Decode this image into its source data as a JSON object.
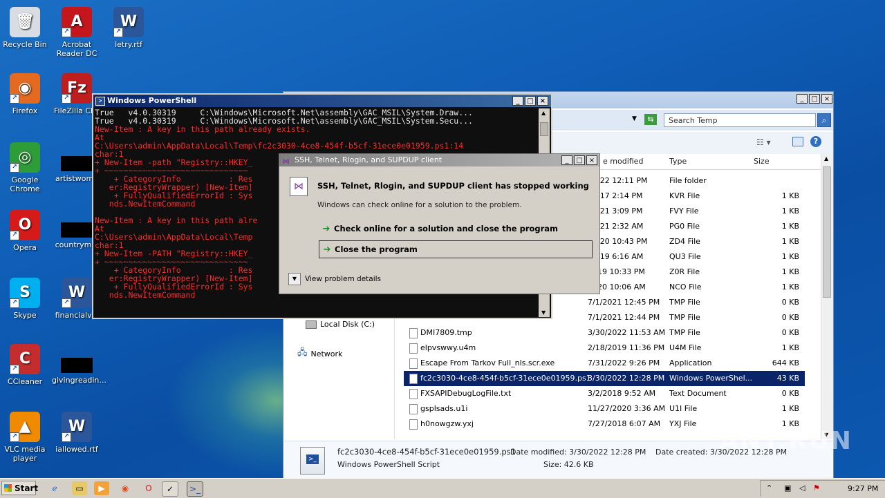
{
  "desktop": {
    "icons": [
      {
        "label": "Recycle Bin"
      },
      {
        "label": "Acrobat Reader DC"
      },
      {
        "label": "letry.rtf"
      },
      {
        "label": "Firefox"
      },
      {
        "label": "FileZilla Clie"
      },
      {
        "label": "Google Chrome"
      },
      {
        "label": "artistwome"
      },
      {
        "label": "Opera"
      },
      {
        "label": "countrymin"
      },
      {
        "label": "Skype"
      },
      {
        "label": "financialvol"
      },
      {
        "label": "CCleaner"
      },
      {
        "label": "givingreadin..."
      },
      {
        "label": "VLC media player"
      },
      {
        "label": "iallowed.rtf"
      }
    ]
  },
  "explorer": {
    "search_placeholder": "Search Temp",
    "columns": {
      "modified": "e modified",
      "type": "Type",
      "size": "Size"
    },
    "nav": [
      {
        "label": "Local Disk (C:)"
      },
      {
        "label": "Network"
      }
    ],
    "rows": [
      {
        "name": "",
        "modified": "/2022 12:11 PM",
        "type": "File folder",
        "size": ""
      },
      {
        "name": "",
        "modified": "/2017 2:14 PM",
        "type": "KVR File",
        "size": "1 KB"
      },
      {
        "name": "",
        "modified": "/2021 3:09 PM",
        "type": "FVY File",
        "size": "1 KB"
      },
      {
        "name": "",
        "modified": "/2021 2:32 AM",
        "type": "PG0 File",
        "size": "1 KB"
      },
      {
        "name": "",
        "modified": "/2020 10:43 PM",
        "type": "ZD4 File",
        "size": "1 KB"
      },
      {
        "name": "",
        "modified": "/2019 6:16 AM",
        "type": "QU3 File",
        "size": "1 KB"
      },
      {
        "name": "",
        "modified": "2019 10:33 PM",
        "type": "Z0R File",
        "size": "1 KB"
      },
      {
        "name": "",
        "modified": "2020 10:06 AM",
        "type": "NCO File",
        "size": "1 KB"
      },
      {
        "name": "",
        "modified": "7/1/2021 12:45 PM",
        "type": "TMP File",
        "size": "0 KB"
      },
      {
        "name": "",
        "modified": "7/1/2021 12:44 PM",
        "type": "TMP File",
        "size": "0 KB"
      },
      {
        "name": "DMI7809.tmp",
        "modified": "3/30/2022 11:53 AM",
        "type": "TMP File",
        "size": "0 KB"
      },
      {
        "name": "elpvswwy.u4m",
        "modified": "2/18/2019 11:36 PM",
        "type": "U4M File",
        "size": "1 KB"
      },
      {
        "name": "Escape From Tarkov Full_nls.scr.exe",
        "modified": "7/31/2022 9:26 PM",
        "type": "Application",
        "size": "644 KB"
      },
      {
        "name": "fc2c3030-4ce8-454f-b5cf-31ece0e01959.ps1",
        "modified": "3/30/2022 12:28 PM",
        "type": "Windows PowerShel...",
        "size": "43 KB"
      },
      {
        "name": "FXSAPIDebugLogFile.txt",
        "modified": "3/2/2018 9:52 AM",
        "type": "Text Document",
        "size": "0 KB"
      },
      {
        "name": "gsplsads.u1i",
        "modified": "11/27/2020 3:36 AM",
        "type": "U1I File",
        "size": "1 KB"
      },
      {
        "name": "h0nowgzw.yxj",
        "modified": "7/27/2018 6:07 AM",
        "type": "YXJ File",
        "size": "1 KB"
      }
    ],
    "details": {
      "filename": "fc2c3030-4ce8-454f-b5cf-31ece0e01959.ps1",
      "filetype": "Windows PowerShell Script",
      "date_modified": "Date modified: 3/30/2022 12:28 PM",
      "size": "Size: 42.6 KB",
      "date_created": "Date created: 3/30/2022 12:28 PM"
    }
  },
  "powershell": {
    "title": "Windows PowerShell",
    "lines": [
      {
        "cls": "w",
        "text": "True   v4.0.30319     C:\\Windows\\Microsoft.Net\\assembly\\GAC_MSIL\\System.Draw..."
      },
      {
        "cls": "w",
        "text": "True   v4.0.30319     C:\\Windows\\Microsoft.Net\\assembly\\GAC_MSIL\\System.Secu..."
      },
      {
        "cls": "r",
        "text": "New-Item : A key in this path already exists."
      },
      {
        "cls": "r",
        "text": "At"
      },
      {
        "cls": "r",
        "text": "C:\\Users\\admin\\AppData\\Local\\Temp\\fc2c3030-4ce8-454f-b5cf-31ece0e01959.ps1:14"
      },
      {
        "cls": "r",
        "text": "char:1"
      },
      {
        "cls": "r",
        "text": "+ New-Item -path \"Registry::HKEY_"
      },
      {
        "cls": "r",
        "text": "+ ~~~~~~~~~~~~~~~~~~~~~~~~~~~~~~"
      },
      {
        "cls": "r",
        "text": "    + CategoryInfo          : Res"
      },
      {
        "cls": "r",
        "text": "   er:RegistryWrapper) [New-Item]"
      },
      {
        "cls": "r",
        "text": "    + FullyQualifiedErrorId : Sys"
      },
      {
        "cls": "r",
        "text": "   nds.NewItemCommand"
      },
      {
        "cls": "r",
        "text": ""
      },
      {
        "cls": "r",
        "text": "New-Item : A key in this path alre"
      },
      {
        "cls": "r",
        "text": "At"
      },
      {
        "cls": "r",
        "text": "C:\\Users\\admin\\AppData\\Local\\Temp"
      },
      {
        "cls": "r",
        "text": "char:1"
      },
      {
        "cls": "r",
        "text": "+ New-Item -PATH \"Registry::HKEY_"
      },
      {
        "cls": "r",
        "text": "+ ~~~~~~~~~~~~~~~~~~~~~~~~~~~~~~"
      },
      {
        "cls": "r",
        "text": "    + CategoryInfo          : Res"
      },
      {
        "cls": "r",
        "text": "   er:RegistryWrapper) [New-Item]"
      },
      {
        "cls": "r",
        "text": "    + FullyQualifiedErrorId : Sys"
      },
      {
        "cls": "r",
        "text": "   nds.NewItemCommand"
      }
    ]
  },
  "dialog": {
    "title": "SSH, Telnet, Rlogin, and SUPDUP client",
    "heading": "SSH, Telnet, Rlogin, and SUPDUP client has stopped working",
    "subtext": "Windows can check online for a solution to the problem.",
    "option_check": "Check online for a solution and close the program",
    "option_close": "Close the program",
    "details": "View problem details"
  },
  "taskbar": {
    "start": "Start",
    "clock": "9:27 PM"
  },
  "watermark": "ANY.RUN"
}
